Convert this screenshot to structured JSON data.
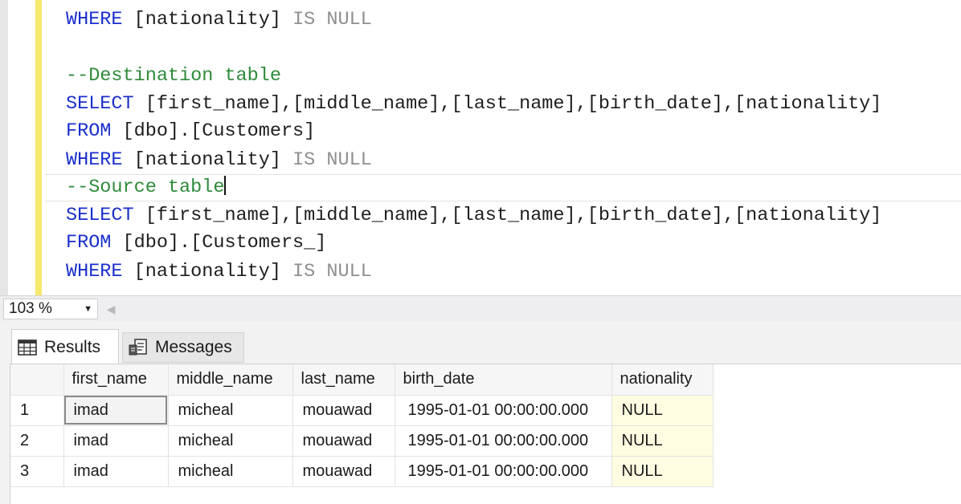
{
  "editor": {
    "lines": [
      {
        "kw": "WHERE",
        "rest": " [nationality] ",
        "gray": "IS NULL"
      },
      {
        "comment": "--Destination table"
      },
      {
        "kw": "SELECT",
        "rest": " [first_name],[middle_name],[last_name],[birth_date],[nationality]"
      },
      {
        "kw": "FROM",
        "rest": " [dbo].[Customers]"
      },
      {
        "kw": "WHERE",
        "rest": " [nationality] ",
        "gray": "IS NULL"
      },
      {
        "comment": "--Source table"
      },
      {
        "kw": "SELECT",
        "rest": " [first_name],[middle_name],[last_name],[birth_date],[nationality]"
      },
      {
        "kw": "FROM",
        "rest": " [dbo].[Customers_]"
      },
      {
        "kw": "WHERE",
        "rest": " [nationality] ",
        "gray": "IS NULL"
      }
    ]
  },
  "statusbar": {
    "zoom": "103 %"
  },
  "tabs": {
    "results": "Results",
    "messages": "Messages"
  },
  "grid": {
    "columns": [
      "first_name",
      "middle_name",
      "last_name",
      "birth_date",
      "nationality"
    ],
    "rows": [
      {
        "num": "1",
        "first_name": "imad",
        "middle_name": "micheal",
        "last_name": "mouawad",
        "birth_date": "1995-01-01 00:00:00.000",
        "nationality": "NULL"
      },
      {
        "num": "2",
        "first_name": "imad",
        "middle_name": "micheal",
        "last_name": "mouawad",
        "birth_date": "1995-01-01 00:00:00.000",
        "nationality": "NULL"
      },
      {
        "num": "3",
        "first_name": "imad",
        "middle_name": "micheal",
        "last_name": "mouawad",
        "birth_date": "1995-01-01 00:00:00.000",
        "nationality": "NULL"
      }
    ]
  },
  "colors": {
    "keyword": "#1a2fcc",
    "comment": "#2f8a3a",
    "null_keyword": "#8f8f8f",
    "null_cell": "#fffde1",
    "change_bar": "#f4e96b"
  }
}
